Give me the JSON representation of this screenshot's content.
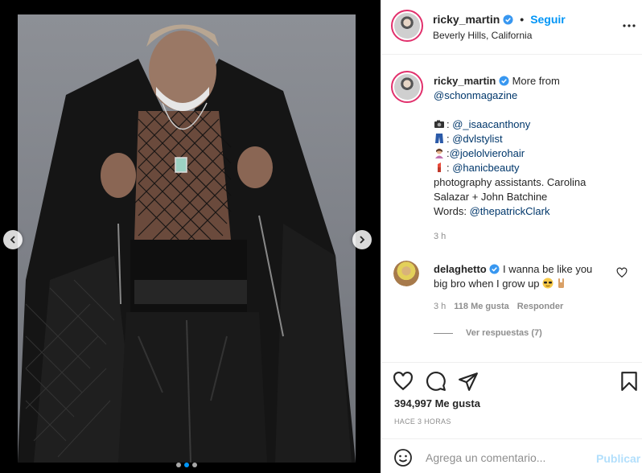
{
  "post": {
    "author": "ricky_martin",
    "follow_label": "Seguir",
    "location": "Beverly Hills, California",
    "separator": "•"
  },
  "caption": {
    "username": "ricky_martin",
    "intro": "More from",
    "magazine": "@schonmagazine",
    "credits": [
      {
        "icon": "camera-icon",
        "prefix": ": ",
        "handle": "@_isaacanthony"
      },
      {
        "icon": "jeans-icon",
        "prefix": ": ",
        "handle": "@dvlstylist"
      },
      {
        "icon": "hairdresser-icon",
        "prefix": ":",
        "handle": "@joelolvierohair"
      },
      {
        "icon": "lipstick-icon",
        "prefix": ": ",
        "handle": "@hanicbeauty"
      }
    ],
    "assistants_line1": "photography assistants. Carolina",
    "assistants_line2": "Salazar + John Batchine",
    "words_label": "Words:",
    "words_handle": "@thepatrickClark",
    "time": "3 h"
  },
  "comment": {
    "username": "delaghetto",
    "text_line1": "I wanna be like you",
    "text_line2": "big bro when I grow up",
    "emojis": [
      "sunglasses-face-icon",
      "rock-hand-icon"
    ],
    "time": "3 h",
    "likes": "118 Me gusta",
    "reply_label": "Responder",
    "view_replies": "Ver respuestas (7)"
  },
  "engagement": {
    "likes": "394,997 Me gusta",
    "posted": "HACE 3 HORAS"
  },
  "composer": {
    "placeholder": "Agrega un comentario...",
    "publish_label": "Publicar"
  },
  "carousel": {
    "total_slides": 3,
    "active_slide": 2
  },
  "colors": {
    "accent": "#0095f6",
    "mention": "#00376b",
    "muted": "#8e8e8e",
    "publish_disabled": "#b2dffc"
  }
}
